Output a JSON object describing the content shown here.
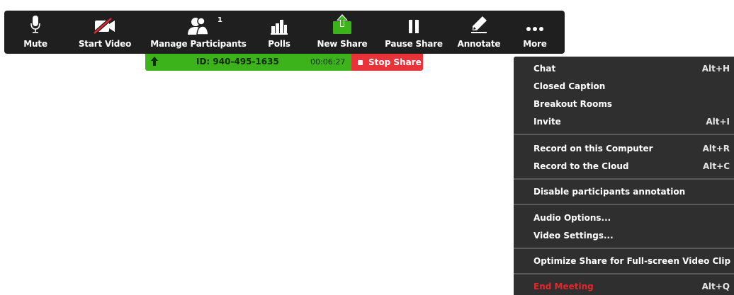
{
  "toolbar": {
    "mute_label": "Mute",
    "start_video_label": "Start Video",
    "manage_participants_label": "Manage Participants",
    "participants_count": "1",
    "polls_label": "Polls",
    "new_share_label": "New Share",
    "pause_share_label": "Pause Share",
    "annotate_label": "Annotate",
    "more_label": "More"
  },
  "share_bar": {
    "meeting_id": "ID: 940-495-1635",
    "elapsed": "00:06:27",
    "stop_label": "Stop Share"
  },
  "more_menu": {
    "items": [
      {
        "label": "Chat",
        "shortcut": "Alt+H"
      },
      {
        "label": "Closed Caption",
        "shortcut": ""
      },
      {
        "label": "Breakout Rooms",
        "shortcut": ""
      },
      {
        "label": "Invite",
        "shortcut": "Alt+I"
      },
      {
        "label": "Record on this Computer",
        "shortcut": "Alt+R"
      },
      {
        "label": "Record to the Cloud",
        "shortcut": "Alt+C"
      },
      {
        "label": "Disable participants annotation",
        "shortcut": ""
      },
      {
        "label": "Audio Options...",
        "shortcut": ""
      },
      {
        "label": "Video Settings...",
        "shortcut": ""
      },
      {
        "label": "Optimize Share for Full-screen Video Clip",
        "shortcut": ""
      },
      {
        "label": "End Meeting",
        "shortcut": "Alt+Q"
      }
    ]
  },
  "colors": {
    "toolbar_bg": "#1f1f1f",
    "share_green": "#3cb21b",
    "stop_red": "#e8333a",
    "menu_bg": "#2f2f2f",
    "danger_red": "#e5272c"
  },
  "icons": {
    "mute": "microphone-icon",
    "start_video": "video-off-icon",
    "manage_participants": "participants-icon",
    "polls": "poll-chart-icon",
    "new_share": "share-screen-icon",
    "pause_share": "pause-icon",
    "annotate": "pencil-icon",
    "more": "more-dots-icon",
    "share_bar": "share-arrow-icon"
  }
}
